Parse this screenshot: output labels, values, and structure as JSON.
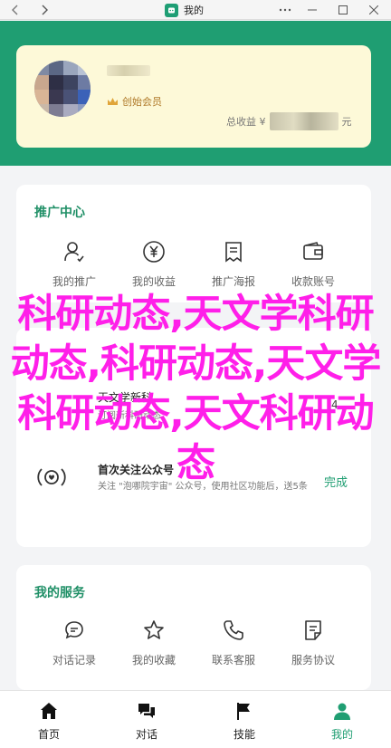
{
  "window": {
    "back_icon": "chevron-left-icon",
    "forward_icon": "chevron-right-icon",
    "title": "我的",
    "controls": [
      "more-icon",
      "minimize-icon",
      "maximize-icon",
      "close-icon"
    ]
  },
  "profile": {
    "member_label": "创始会员",
    "earnings_prefix": "总收益 ¥",
    "earnings_suffix": "元"
  },
  "promo": {
    "title": "推广中心",
    "items": [
      {
        "label": "我的推广",
        "icon": "user-icon"
      },
      {
        "label": "我的收益",
        "icon": "yuan-coin-icon"
      },
      {
        "label": "推广海报",
        "icon": "poster-icon"
      },
      {
        "label": "收款账号",
        "icon": "wallet-icon"
      }
    ]
  },
  "notifications": {
    "notice_title": "天文学新科",
    "notice_desc": "订阅新科研动态",
    "notice_status": "4",
    "follow_title": "首次关注公众号",
    "follow_desc": "关注 \"泡哪院宇宙\" 公众号，使用社区功能后，送5条",
    "follow_status": "完成"
  },
  "services": {
    "title": "我的服务",
    "items": [
      {
        "label": "对话记录",
        "icon": "chat-record-icon"
      },
      {
        "label": "我的收藏",
        "icon": "star-icon"
      },
      {
        "label": "联系客服",
        "icon": "phone-icon"
      },
      {
        "label": "服务协议",
        "icon": "agreement-icon"
      }
    ]
  },
  "bottom_nav": [
    {
      "label": "首页",
      "icon": "home-icon",
      "active": false
    },
    {
      "label": "对话",
      "icon": "chat-icon",
      "active": false
    },
    {
      "label": "技能",
      "icon": "flag-icon",
      "active": false
    },
    {
      "label": "我的",
      "icon": "profile-icon",
      "active": true
    }
  ],
  "watermark": {
    "text": "科研动态,天文学科研动态,科研动态,天文学科研动态,天文科研动态"
  },
  "colors": {
    "brand_green": "#1f9e72",
    "card_yellow": "#fdf9d8",
    "watermark_magenta": "#ff1fe9"
  }
}
